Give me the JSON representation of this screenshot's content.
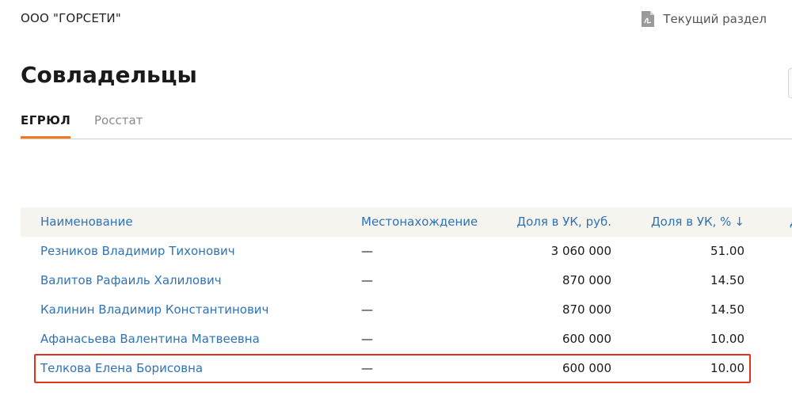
{
  "header": {
    "company": "ООО \"ГОРСЕТИ\"",
    "section_link": "Текущий раздел",
    "section_icon": "pdf-icon"
  },
  "page": {
    "title": "Совладельцы"
  },
  "tabs": [
    {
      "label": "ЕГРЮЛ",
      "active": true
    },
    {
      "label": "Росстат",
      "active": false
    }
  ],
  "table": {
    "columns": {
      "name": "Наименование",
      "location": "Местонахождение",
      "share_rub": "Доля в УК, руб.",
      "share_pct": "Доля в УК, %",
      "share_pct_sort": "↓",
      "extra": "Д"
    },
    "rows": [
      {
        "name": "Резников Владимир Тихонович",
        "location": "—",
        "share_rub": "3 060 000",
        "share_pct": "51.00"
      },
      {
        "name": "Валитов Рафаиль Халилович",
        "location": "—",
        "share_rub": "870 000",
        "share_pct": "14.50"
      },
      {
        "name": "Калинин Владимир Константинович",
        "location": "—",
        "share_rub": "870 000",
        "share_pct": "14.50"
      },
      {
        "name": "Афанасьева Валентина Матвеевна",
        "location": "—",
        "share_rub": "600 000",
        "share_pct": "10.00"
      },
      {
        "name": "Телкова Елена Борисовна",
        "location": "—",
        "share_rub": "600 000",
        "share_pct": "10.00",
        "highlighted": true
      }
    ]
  },
  "colors": {
    "accent": "#ee7a21",
    "link": "#2f73b5",
    "highlight_border": "#e2331d",
    "header_bg": "#f6f4ef"
  }
}
